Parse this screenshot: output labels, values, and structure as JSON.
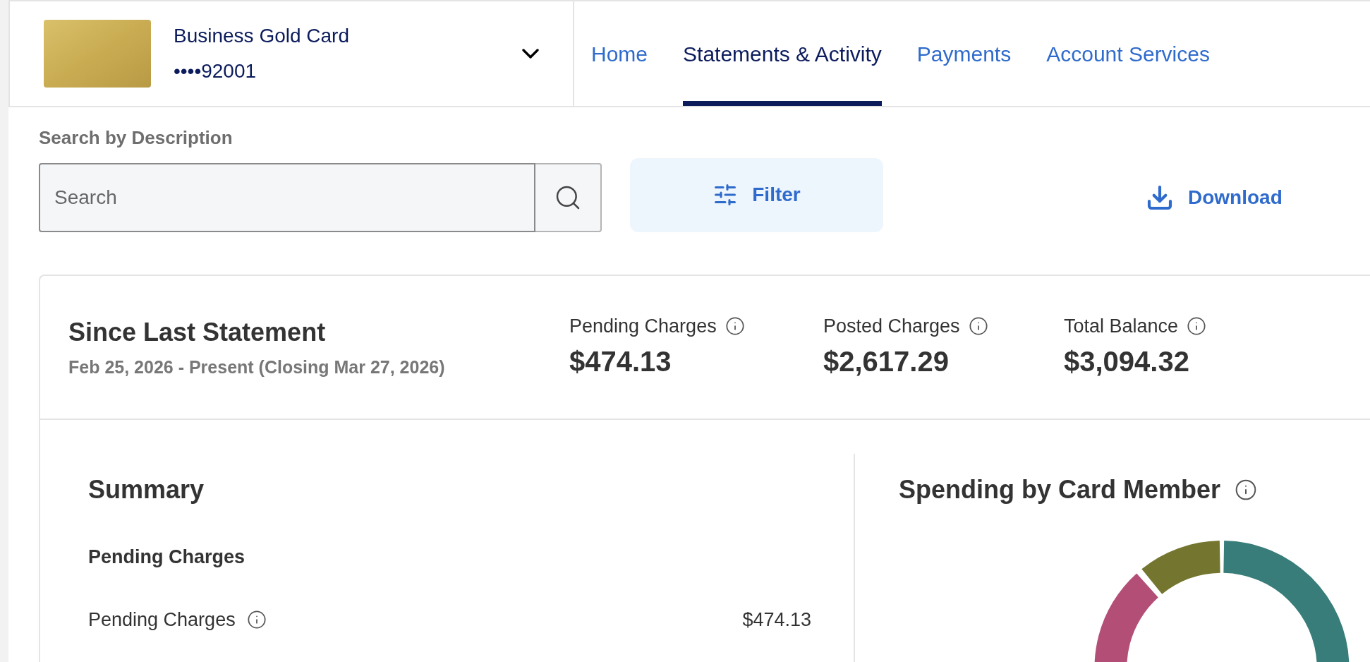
{
  "account": {
    "name": "Business Gold Card",
    "number": "••••92001"
  },
  "nav_tabs": [
    {
      "label": "Home",
      "selected": false
    },
    {
      "label": "Statements & Activity",
      "selected": true
    },
    {
      "label": "Payments",
      "selected": false
    },
    {
      "label": "Account Services",
      "selected": false
    }
  ],
  "search": {
    "label": "Search by Description",
    "placeholder": "Search"
  },
  "filter_button": "Filter",
  "download_button": "Download",
  "since_last_statement": {
    "title": "Since Last Statement",
    "period": "Feb 25, 2026 - Present (Closing Mar 27, 2026)",
    "metrics": [
      {
        "label": "Pending Charges",
        "value": "$474.13"
      },
      {
        "label": "Posted Charges",
        "value": "$2,617.29"
      },
      {
        "label": "Total Balance",
        "value": "$3,094.32"
      }
    ]
  },
  "summary": {
    "title": "Summary",
    "section": "Pending Charges",
    "rows": [
      {
        "label": "Pending Charges",
        "value": "$474.13"
      }
    ]
  },
  "spending": {
    "title": "Spending by Card Member"
  }
}
